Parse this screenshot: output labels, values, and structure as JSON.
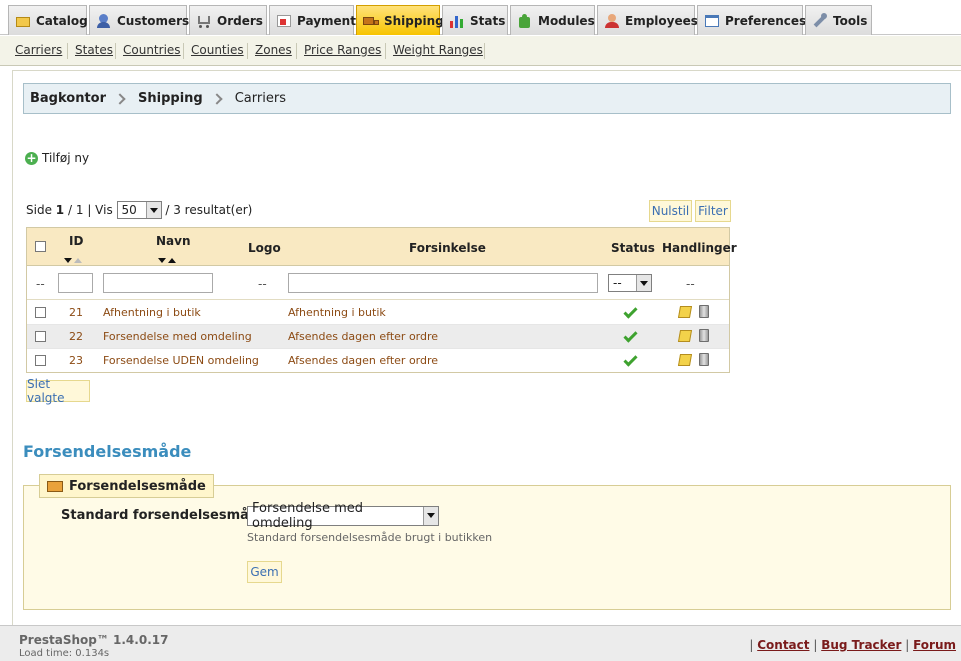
{
  "tabs": [
    {
      "label": "Catalog",
      "icon": "folder-icon"
    },
    {
      "label": "Customers",
      "icon": "customers-icon"
    },
    {
      "label": "Orders",
      "icon": "cart-icon"
    },
    {
      "label": "Payment",
      "icon": "payment-icon"
    },
    {
      "label": "Shipping",
      "icon": "truck-icon",
      "active": true
    },
    {
      "label": "Stats",
      "icon": "chart-icon"
    },
    {
      "label": "Modules",
      "icon": "puzzle-icon"
    },
    {
      "label": "Employees",
      "icon": "employee-icon"
    },
    {
      "label": "Preferences",
      "icon": "preferences-icon"
    },
    {
      "label": "Tools",
      "icon": "wrench-icon"
    }
  ],
  "subtabs": [
    "Carriers",
    "States",
    "Countries",
    "Counties",
    "Zones",
    "Price Ranges",
    "Weight Ranges"
  ],
  "breadcrumb": [
    "Bagkontor",
    "Shipping",
    "Carriers"
  ],
  "add_new": "Tilføj ny",
  "pager": {
    "side_label": "Side",
    "page": "1",
    "sep": "/",
    "pages": "1",
    "vis_label": "| Vis",
    "per_page": "50",
    "results": "/ 3 resultat(er)"
  },
  "buttons": {
    "reset": "Nulstil",
    "filter": "Filter",
    "delete_selected": "Slet valgte",
    "save": "Gem"
  },
  "table": {
    "headers": {
      "id": "ID",
      "name": "Navn",
      "logo": "Logo",
      "delay": "Forsinkelse",
      "status": "Status",
      "actions": "Handlinger"
    },
    "filter_placeholders": {
      "id": "--",
      "logo": "--",
      "status": "--",
      "actions": "--"
    },
    "rows": [
      {
        "id": "21",
        "name": "Afhentning i butik",
        "delay": "Afhentning i butik",
        "status": "enabled"
      },
      {
        "id": "22",
        "name": "Forsendelse med omdeling",
        "delay": "Afsendes dagen efter ordre",
        "status": "enabled"
      },
      {
        "id": "23",
        "name": "Forsendelse UDEN omdeling",
        "delay": "Afsendes dagen efter ordre",
        "status": "enabled"
      }
    ]
  },
  "shipping_method": {
    "section_title": "Forsendelsesmåde",
    "legend": "Forsendelsesmåde",
    "label": "Standard forsendelsesmåde",
    "selected": "Forsendelse med omdeling",
    "hint": "Standard forsendelsesmåde brugt i butikken"
  },
  "footer": {
    "brand": "PrestaShop™ 1.4.0.17",
    "load_time": "Load time: 0.134s",
    "sep": "|",
    "links": [
      "Contact",
      "Bug Tracker",
      "Forum"
    ]
  },
  "colors": {
    "active_tab": "#f7c400",
    "link_brown": "#8c4b14",
    "section_blue": "#3b8dbd"
  }
}
